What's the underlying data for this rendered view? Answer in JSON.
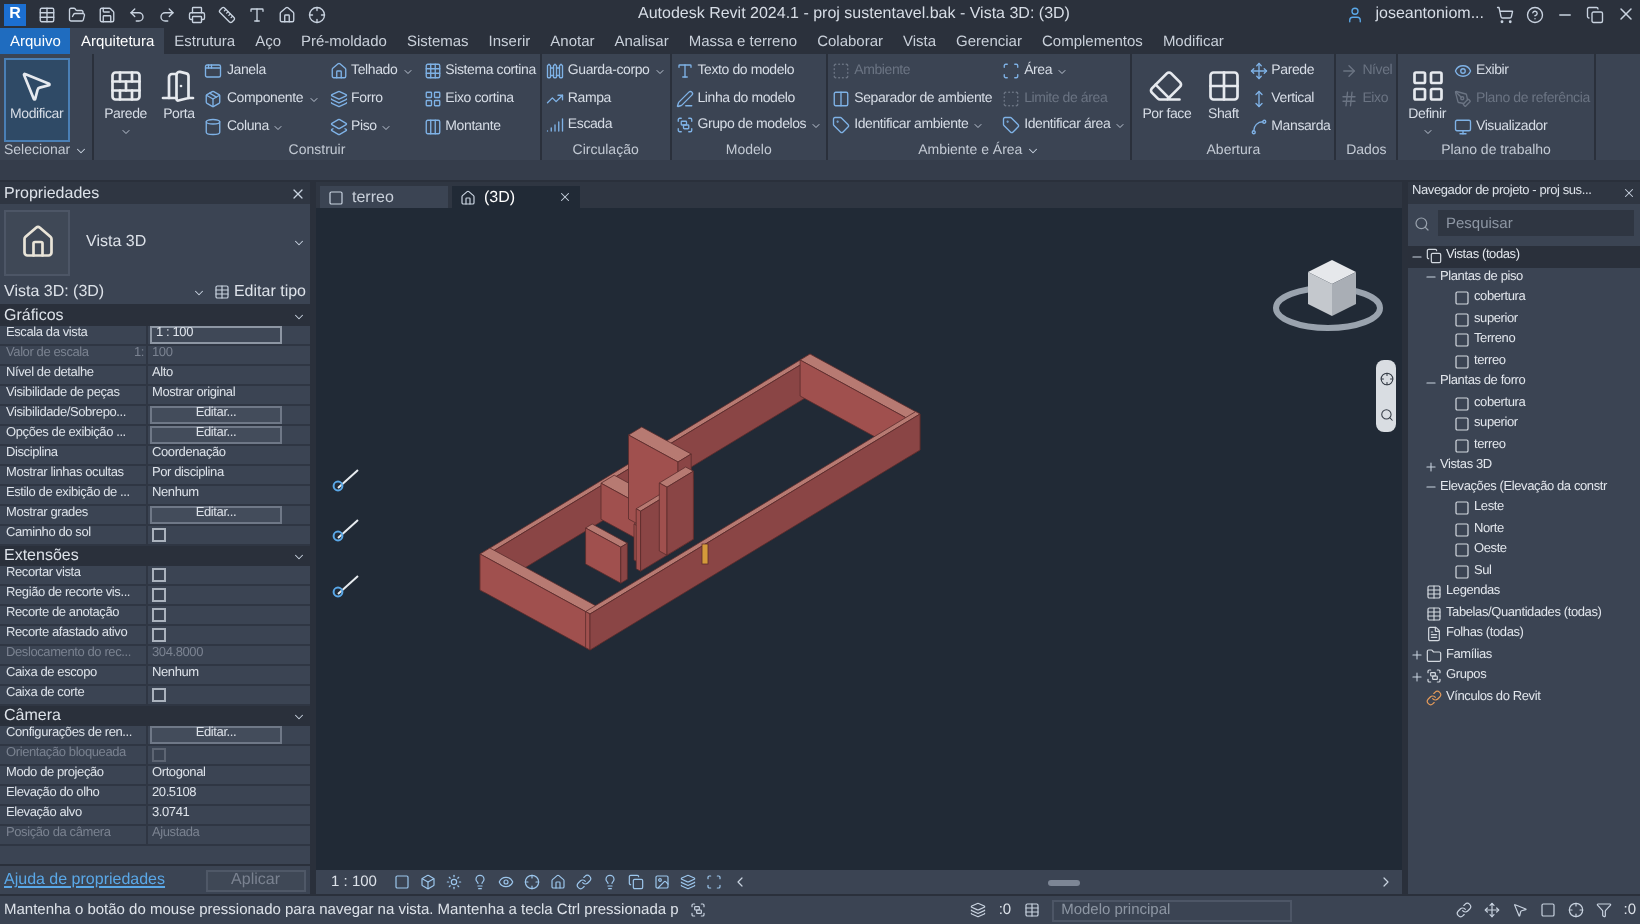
{
  "title_bar": {
    "logo": "R",
    "title": "Autodesk Revit 2024.1 - proj sustentavel.bak - Vista 3D: (3D)",
    "user": "joseantoniom..."
  },
  "tabs": [
    {
      "label": "Arquivo",
      "kind": "file",
      "selected": false
    },
    {
      "label": "Arquitetura",
      "kind": "tab",
      "selected": true
    },
    {
      "label": "Estrutura",
      "kind": "tab",
      "selected": false
    },
    {
      "label": "Aço",
      "kind": "tab",
      "selected": false
    },
    {
      "label": "Pré-moldado",
      "kind": "tab",
      "selected": false
    },
    {
      "label": "Sistemas",
      "kind": "tab",
      "selected": false
    },
    {
      "label": "Inserir",
      "kind": "tab",
      "selected": false
    },
    {
      "label": "Anotar",
      "kind": "tab",
      "selected": false
    },
    {
      "label": "Analisar",
      "kind": "tab",
      "selected": false
    },
    {
      "label": "Massa e terreno",
      "kind": "tab",
      "selected": false
    },
    {
      "label": "Colaborar",
      "kind": "tab",
      "selected": false
    },
    {
      "label": "Vista",
      "kind": "tab",
      "selected": false
    },
    {
      "label": "Gerenciar",
      "kind": "tab",
      "selected": false
    },
    {
      "label": "Complementos",
      "kind": "tab",
      "selected": false
    },
    {
      "label": "Modificar",
      "kind": "tab",
      "selected": false
    }
  ],
  "ribbon": [
    {
      "label": "Selecionar",
      "menu": true,
      "items": [
        {
          "label": "Modificar",
          "kind": "large",
          "selected": true
        }
      ]
    },
    {
      "label": "Construir",
      "items": [
        {
          "label": "Parede",
          "kind": "large",
          "dropdown": true
        },
        {
          "label": "Porta",
          "kind": "large"
        },
        {
          "label": "Janela",
          "kind": "small"
        },
        {
          "label": "Componente",
          "kind": "small",
          "dropdown": true
        },
        {
          "label": "Coluna",
          "kind": "small",
          "dropdown": true
        },
        {
          "label": "Telhado",
          "kind": "small",
          "dropdown": true
        },
        {
          "label": "Forro",
          "kind": "small"
        },
        {
          "label": "Piso",
          "kind": "small",
          "dropdown": true
        },
        {
          "label": "Sistema cortina",
          "kind": "small"
        },
        {
          "label": "Eixo cortina",
          "kind": "small"
        },
        {
          "label": "Montante",
          "kind": "small"
        }
      ]
    },
    {
      "label": "Circulação",
      "items": [
        {
          "label": "Guarda-corpo",
          "kind": "small",
          "dropdown": true
        },
        {
          "label": "Rampa",
          "kind": "small"
        },
        {
          "label": "Escada",
          "kind": "small"
        }
      ]
    },
    {
      "label": "Modelo",
      "items": [
        {
          "label": "Texto do modelo",
          "kind": "small"
        },
        {
          "label": "Linha do modelo",
          "kind": "small"
        },
        {
          "label": "Grupo de modelos",
          "kind": "small",
          "dropdown": true
        }
      ]
    },
    {
      "label": "Ambiente e Área",
      "menu": true,
      "items": [
        {
          "label": "Ambiente",
          "kind": "small",
          "disabled": true
        },
        {
          "label": "Separador de ambiente",
          "kind": "small",
          "disabled": false
        },
        {
          "label": "Identificar ambiente",
          "kind": "small",
          "dropdown": true,
          "disabled": false
        },
        {
          "label": "Área",
          "kind": "small",
          "dropdown": true,
          "disabled": false
        },
        {
          "label": "Limite de área",
          "kind": "small",
          "disabled": true
        },
        {
          "label": "Identificar área",
          "kind": "small",
          "dropdown": true,
          "disabled": false
        }
      ]
    },
    {
      "label": "Abertura",
      "items": [
        {
          "label": "Por face",
          "kind": "large"
        },
        {
          "label": "Shaft",
          "kind": "large"
        },
        {
          "label": "Parede",
          "kind": "small"
        },
        {
          "label": "Vertical",
          "kind": "small"
        },
        {
          "label": "Mansarda",
          "kind": "small"
        }
      ]
    },
    {
      "label": "Dados",
      "items": [
        {
          "label": "Nível",
          "kind": "small",
          "disabled": true
        },
        {
          "label": "Eixo",
          "kind": "small",
          "disabled": true
        }
      ]
    },
    {
      "label": "Plano de trabalho",
      "items": [
        {
          "label": "Definir",
          "kind": "large",
          "dropdown": true
        },
        {
          "label": "Exibir",
          "kind": "small",
          "disabled": false
        },
        {
          "label": "Plano de referência",
          "kind": "small",
          "disabled": true
        },
        {
          "label": "Visualizador",
          "kind": "small",
          "disabled": false
        }
      ]
    }
  ],
  "properties": {
    "title": "Propriedades",
    "type_name": "Vista 3D",
    "selector": "Vista 3D: (3D)",
    "edit_type": "Editar tipo",
    "sections": [
      {
        "title": "Gráficos",
        "rows": [
          {
            "label": "Escala da vista",
            "value": "1 : 100",
            "kind": "field"
          },
          {
            "label": "Valor de escala",
            "unit": "1:",
            "value": "100",
            "kind": "text",
            "disabled": true
          },
          {
            "label": "Nível de detalhe",
            "value": "Alto",
            "kind": "text"
          },
          {
            "label": "Visibilidade de peças",
            "value": "Mostrar original",
            "kind": "text"
          },
          {
            "label": "Visibilidade/Sobrepo...",
            "value": "Editar...",
            "kind": "button"
          },
          {
            "label": "Opções de exibição ...",
            "value": "Editar...",
            "kind": "button"
          },
          {
            "label": "Disciplina",
            "value": "Coordenação",
            "kind": "text"
          },
          {
            "label": "Mostrar linhas ocultas",
            "value": "Por disciplina",
            "kind": "text"
          },
          {
            "label": "Estilo de exibição de ...",
            "value": "Nenhum",
            "kind": "text"
          },
          {
            "label": "Mostrar grades",
            "value": "Editar...",
            "kind": "button"
          },
          {
            "label": "Caminho do sol",
            "kind": "checkbox",
            "checked": false
          }
        ]
      },
      {
        "title": "Extensões",
        "rows": [
          {
            "label": "Recortar vista",
            "kind": "checkbox",
            "checked": false
          },
          {
            "label": "Região de recorte vis...",
            "kind": "checkbox",
            "checked": false
          },
          {
            "label": "Recorte de anotação",
            "kind": "checkbox",
            "checked": false
          },
          {
            "label": "Recorte afastado ativo",
            "kind": "checkbox",
            "checked": false
          },
          {
            "label": "Deslocamento do rec...",
            "value": "304.8000",
            "kind": "text",
            "disabled": true
          },
          {
            "label": "Caixa de escopo",
            "value": "Nenhum",
            "kind": "text"
          },
          {
            "label": "Caixa de corte",
            "kind": "checkbox",
            "checked": false
          }
        ]
      },
      {
        "title": "Câmera",
        "rows": [
          {
            "label": "Configurações de ren...",
            "value": "Editar...",
            "kind": "button"
          },
          {
            "label": "Orientação bloqueada",
            "kind": "checkbox",
            "checked": false,
            "disabled": true
          },
          {
            "label": "Modo de projeção",
            "value": "Ortogonal",
            "kind": "text"
          },
          {
            "label": "Elevação do olho",
            "value": "20.5108",
            "kind": "text"
          },
          {
            "label": "Elevação alvo",
            "value": "3.0741",
            "kind": "text"
          },
          {
            "label": "Posição da câmera",
            "value": "Ajustada",
            "kind": "text",
            "disabled": true
          }
        ]
      }
    ],
    "help_link": "Ajuda de propriedades",
    "apply": "Aplicar"
  },
  "view_tabs": [
    {
      "label": "terreo",
      "selected": false
    },
    {
      "label": "(3D)",
      "selected": true
    }
  ],
  "view_scale": "1 : 100",
  "browser": {
    "title": "Navegador de projeto - proj sus...",
    "placeholder": "Pesquisar",
    "tree": [
      {
        "label": "Vistas (todas)",
        "kind": "views",
        "expanded": true,
        "selected": true,
        "children": [
          {
            "label": "Plantas de piso",
            "expanded": true,
            "children": [
              {
                "label": "cobertura",
                "kind": "view"
              },
              {
                "label": "superior",
                "kind": "view"
              },
              {
                "label": "Terreno",
                "kind": "view"
              },
              {
                "label": "terreo",
                "kind": "view"
              }
            ]
          },
          {
            "label": "Plantas de forro",
            "expanded": true,
            "children": [
              {
                "label": "cobertura",
                "kind": "view"
              },
              {
                "label": "superior",
                "kind": "view"
              },
              {
                "label": "terreo",
                "kind": "view"
              }
            ]
          },
          {
            "label": "Vistas 3D",
            "expanded": false
          },
          {
            "label": "Elevações (Elevação da constr",
            "expanded": true,
            "children": [
              {
                "label": "Leste",
                "kind": "view"
              },
              {
                "label": "Norte",
                "kind": "view"
              },
              {
                "label": "Oeste",
                "kind": "view"
              },
              {
                "label": "Sul",
                "kind": "view"
              }
            ]
          }
        ]
      },
      {
        "label": "Legendas",
        "kind": "legend"
      },
      {
        "label": "Tabelas/Quantidades (todas)",
        "kind": "schedule"
      },
      {
        "label": "Folhas (todas)",
        "kind": "sheet"
      },
      {
        "label": "Famílias",
        "kind": "family",
        "expanded": false
      },
      {
        "label": "Grupos",
        "kind": "group",
        "expanded": false
      },
      {
        "label": "Vínculos do Revit",
        "kind": "link"
      }
    ]
  },
  "status_bar": {
    "message": "Mantenha o botão do mouse pressionado para navegar na vista. Mantenha a tecla Ctrl pressionada p",
    "worksets_count": ":0",
    "model": "Modelo principal",
    "filter_count": ":0"
  }
}
